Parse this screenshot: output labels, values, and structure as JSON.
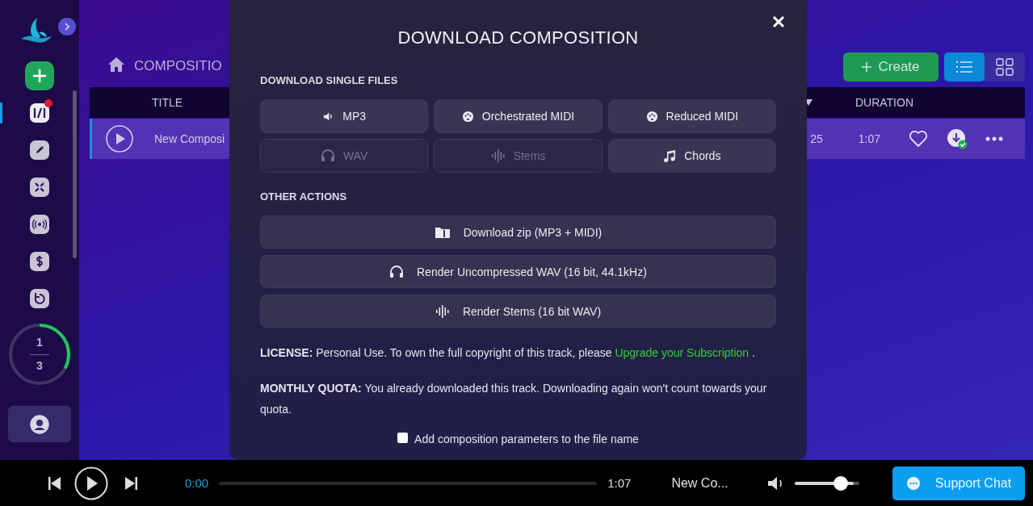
{
  "sidebar": {
    "nav_items": [
      {
        "selected": true,
        "badge": true
      },
      {
        "selected": false,
        "badge": false
      },
      {
        "selected": false,
        "badge": false
      },
      {
        "selected": false,
        "badge": false
      },
      {
        "selected": false,
        "badge": false
      },
      {
        "selected": false,
        "badge": false
      }
    ],
    "quota": {
      "used": "1",
      "total": "3"
    }
  },
  "header": {
    "breadcrumb": "COMPOSITIO",
    "create_button": "Create",
    "views": [
      {
        "selected": true
      },
      {
        "selected": false
      }
    ]
  },
  "table": {
    "columns": [
      "TITLE",
      "DURATION"
    ],
    "rows": [
      {
        "title": "New Composi",
        "column_2": "25",
        "duration": "1:07",
        "liked": false,
        "downloaded": true
      }
    ]
  },
  "modal": {
    "title": "DOWNLOAD COMPOSITION",
    "single_files_label": "DOWNLOAD SINGLE FILES",
    "single_files": [
      {
        "label": "MP3",
        "disabled": false
      },
      {
        "label": "Orchestrated MIDI",
        "disabled": false
      },
      {
        "label": "Reduced MIDI",
        "disabled": false
      },
      {
        "label": "WAV",
        "disabled": true
      },
      {
        "label": "Stems",
        "disabled": true
      },
      {
        "label": "Chords",
        "disabled": false
      }
    ],
    "other_actions_label": "OTHER ACTIONS",
    "other_actions": [
      {
        "label": "Download zip (MP3 + MIDI)"
      },
      {
        "label": "Render Uncompressed WAV (16 bit, 44.1kHz)"
      },
      {
        "label": "Render Stems (16 bit WAV)"
      }
    ],
    "license": {
      "label": "LICENSE:",
      "text": "Personal Use. To own the full copyright of this track, please",
      "link": "Upgrade your Subscription",
      "end": "."
    },
    "quota": {
      "label": "MONTHLY QUOTA:",
      "text": "You already downloaded this track. Downloading again won't count towards your quota."
    },
    "filename_option": {
      "label": "Add composition parameters to the file name",
      "checked": false
    }
  },
  "player": {
    "elapsed": "0:00",
    "progress": {
      "level": 0
    },
    "duration": "1:07",
    "track": "New Co...",
    "volume": {
      "level": 0.92
    },
    "support_button": "Support Chat"
  }
}
